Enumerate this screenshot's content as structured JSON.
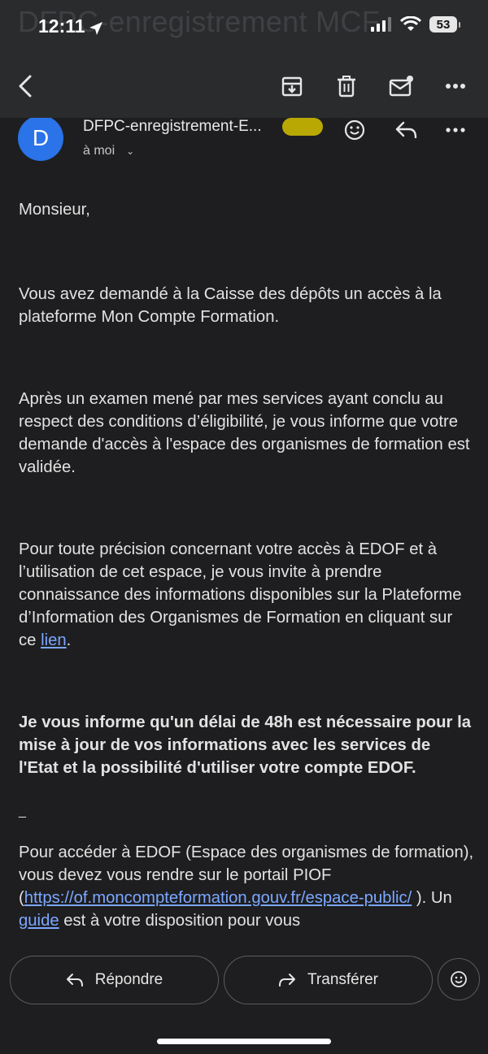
{
  "status_bar": {
    "time": "12:11",
    "battery": "53"
  },
  "ghost_header": {
    "subject": "DFPC-enregistrement MCF",
    "sub": ""
  },
  "toolbar": {
    "back": "back-arrow-icon",
    "archive": "archive-icon",
    "delete": "trash-icon",
    "mark_unread": "mark-unread-icon",
    "more": "more-horiz-icon"
  },
  "message": {
    "avatar_letter": "D",
    "sender": "DFPC-enregistrement-E...",
    "to": "à moi",
    "paragraphs": [
      "Monsieur,",
      "Vous avez demandé à la Caisse des dépôts un accès à la plateforme Mon Compte Formation.",
      "Après un examen mené par mes services ayant conclu au respect des conditions d’éligibilité, je vous informe que votre demande d'accès à l'espace des organismes de formation est validée.",
      "Pour toute précision concernant votre accès à EDOF et à l’utilisation de cet espace, je vous invite à prendre connaissance des informations disponibles sur la Plateforme d’Information des Organismes de Formation en cliquant sur ce",
      "Je vous informe qu'un délai de 48h est nécessaire pour la mise à jour de vos informations avec les services de l'Etat et la possibilité d'utiliser votre compte EDOF.",
      "_",
      "Pour accéder à EDOF (Espace des organismes de formation), vous devez vous rendre sur le portail PIOF ("
    ],
    "link_lien": "lien",
    "after_lien": ".",
    "link_url": "https://of.moncompteformation.gouv.fr/espace-public/",
    "after_url": " ). Un ",
    "link_guide": "guide",
    "after_guide": " est à votre disposition pour vous"
  },
  "bottom_bar": {
    "reply": "Répondre",
    "forward": "Transférer"
  },
  "colors": {
    "background": "#1e1e20",
    "link": "#7ba7ff",
    "avatar": "#2a73e8",
    "redaction": "#b9a804"
  }
}
